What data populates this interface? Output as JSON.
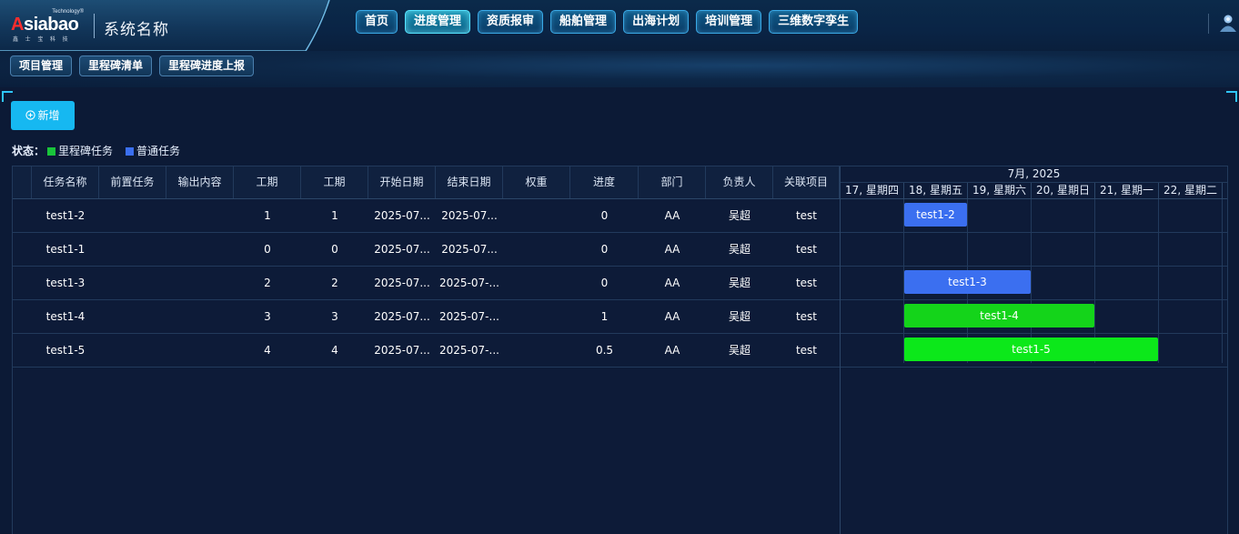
{
  "header": {
    "logo": {
      "tech": "Technology®",
      "main_a": "A",
      "main_rest": "siabao",
      "sub": "鑫 士 宝 科 技"
    },
    "system_title": "系统名称",
    "nav": [
      {
        "label": "首页",
        "active": false
      },
      {
        "label": "进度管理",
        "active": true
      },
      {
        "label": "资质报审",
        "active": false
      },
      {
        "label": "船舶管理",
        "active": false
      },
      {
        "label": "出海计划",
        "active": false
      },
      {
        "label": "培训管理",
        "active": false
      },
      {
        "label": "三维数字孪生",
        "active": false
      }
    ]
  },
  "subnav": [
    "项目管理",
    "里程碑清单",
    "里程碑进度上报"
  ],
  "toolbar": {
    "add_label": "新增",
    "add_icon": "plus-circle-icon"
  },
  "legend": {
    "label": "状态：",
    "items": [
      {
        "label": "里程碑任务",
        "color": "#19c43b"
      },
      {
        "label": "普通任务",
        "color": "#3b6ff0"
      }
    ]
  },
  "table": {
    "columns": [
      "任务名称",
      "前置任务",
      "输出内容",
      "工期",
      "工期",
      "开始日期",
      "结束日期",
      "权重",
      "进度",
      "部门",
      "负责人",
      "关联项目"
    ],
    "rows": [
      [
        "test1-2",
        "",
        "",
        "1",
        "1",
        "2025-07...",
        "2025-07...",
        "",
        "0",
        "AA",
        "吴超",
        "test"
      ],
      [
        "test1-1",
        "",
        "",
        "0",
        "0",
        "2025-07...",
        "2025-07...",
        "",
        "0",
        "AA",
        "吴超",
        "test"
      ],
      [
        "test1-3",
        "",
        "",
        "2",
        "2",
        "2025-07...",
        "2025-07-...",
        "",
        "0",
        "AA",
        "吴超",
        "test"
      ],
      [
        "test1-4",
        "",
        "",
        "3",
        "3",
        "2025-07...",
        "2025-07-...",
        "",
        "1",
        "AA",
        "吴超",
        "test"
      ],
      [
        "test1-5",
        "",
        "",
        "4",
        "4",
        "2025-07...",
        "2025-07-...",
        "",
        "0.5",
        "AA",
        "吴超",
        "test"
      ]
    ]
  },
  "gantt": {
    "month": "7月, 2025",
    "days": [
      "17, 星期四",
      "18, 星期五",
      "19, 星期六",
      "20, 星期日",
      "21, 星期一",
      "22, 星期二"
    ],
    "bars": [
      {
        "label": "test1-2",
        "start": 1,
        "span": 1,
        "type": "normal",
        "color": "#3b6ff0"
      },
      {
        "label": "test1-3",
        "start": 1,
        "span": 2,
        "type": "normal",
        "color": "#3b6ff0"
      },
      {
        "label": "test1-4",
        "start": 1,
        "span": 3,
        "type": "milestone",
        "color": "#14d41a"
      },
      {
        "label": "test1-5",
        "start": 1,
        "span": 4,
        "type": "milestone",
        "color": "#0ce81a"
      }
    ]
  }
}
